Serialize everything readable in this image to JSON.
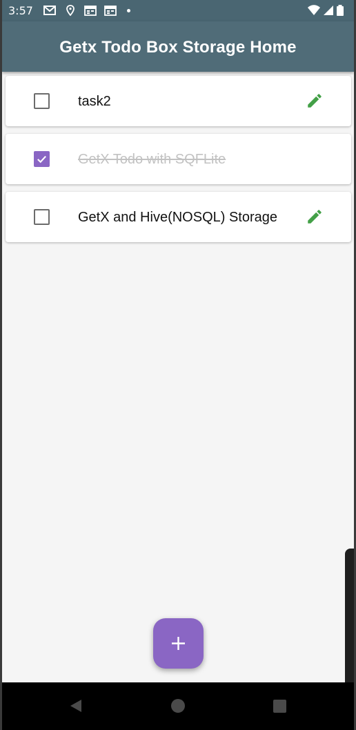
{
  "status_bar": {
    "time": "3:57",
    "left_icons": [
      "gmail-icon",
      "location-pin-icon",
      "calendar-icon",
      "calendar-icon",
      "notification-dot-icon"
    ],
    "right_icons": [
      "wifi-icon",
      "signal-icon",
      "battery-icon"
    ]
  },
  "app_bar": {
    "title": "Getx Todo Box Storage Home",
    "color": "#506c78"
  },
  "todos": [
    {
      "label": "task2",
      "done": false,
      "editable": true
    },
    {
      "label": "GetX Todo with SQFLite",
      "done": true,
      "editable": false
    },
    {
      "label": "GetX and Hive(NOSQL) Storage",
      "done": false,
      "editable": true
    }
  ],
  "fab": {
    "icon": "plus-icon",
    "color": "#8a66c4"
  },
  "colors": {
    "accent": "#8a66c4",
    "edit_icon": "#43a047",
    "done_text": "#c2c2c2"
  },
  "nav_bar": {
    "buttons": [
      "back-icon",
      "home-icon",
      "recents-icon"
    ]
  }
}
